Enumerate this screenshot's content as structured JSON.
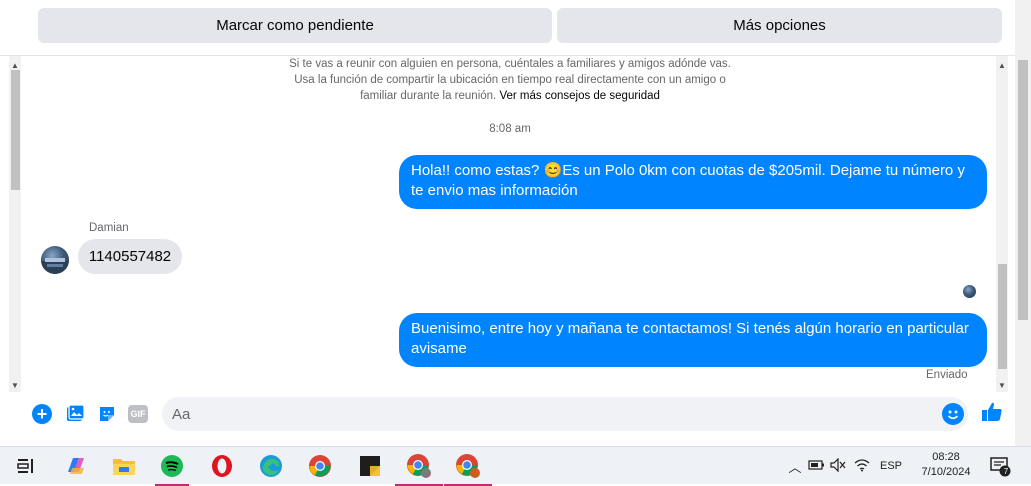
{
  "header": {
    "mark_pending_label": "Marcar como pendiente",
    "more_options_label": "Más opciones"
  },
  "chat": {
    "safety_notice": "Si te vas a reunir con alguien en persona, cuéntales a familiares y amigos adónde vas. Usa la función de compartir la ubicación en tiempo real directamente con un amigo o familiar durante la reunión.",
    "safety_link": "Ver más consejos de seguridad",
    "timestamp": "8:08 am",
    "messages": [
      {
        "direction": "outgoing",
        "text": "Hola!! como estas? 😊Es un Polo 0km con cuotas de $205mil. Dejame tu número y te envio mas información"
      },
      {
        "direction": "incoming",
        "sender": "Damian",
        "text": "1140557482"
      },
      {
        "direction": "outgoing",
        "text": "Buenisimo, entre hoy y mañana te contactamos! Si tenés algún horario en particular avisame"
      }
    ],
    "sent_status": "Enviado"
  },
  "composer": {
    "placeholder": "Aa",
    "gif_label": "GIF",
    "icons": [
      "plus-icon",
      "image-icon",
      "sticker-icon",
      "gif-icon",
      "emoji-icon",
      "like-icon"
    ]
  },
  "taskbar": {
    "apps": [
      "task-view-icon",
      "copilot-icon",
      "file-explorer-icon",
      "spotify-icon",
      "opera-icon",
      "edge-icon",
      "chrome-icon",
      "sticky-notes-icon",
      "chrome-profile-icon",
      "chrome-profile-2-icon"
    ],
    "language": "ESP",
    "time": "08:28",
    "date": "7/10/2024",
    "notification_count": "7"
  },
  "colors": {
    "messenger_blue": "#0084ff",
    "bubble_gray": "#e4e6eb",
    "taskbar_bg": "#eef2f7"
  }
}
